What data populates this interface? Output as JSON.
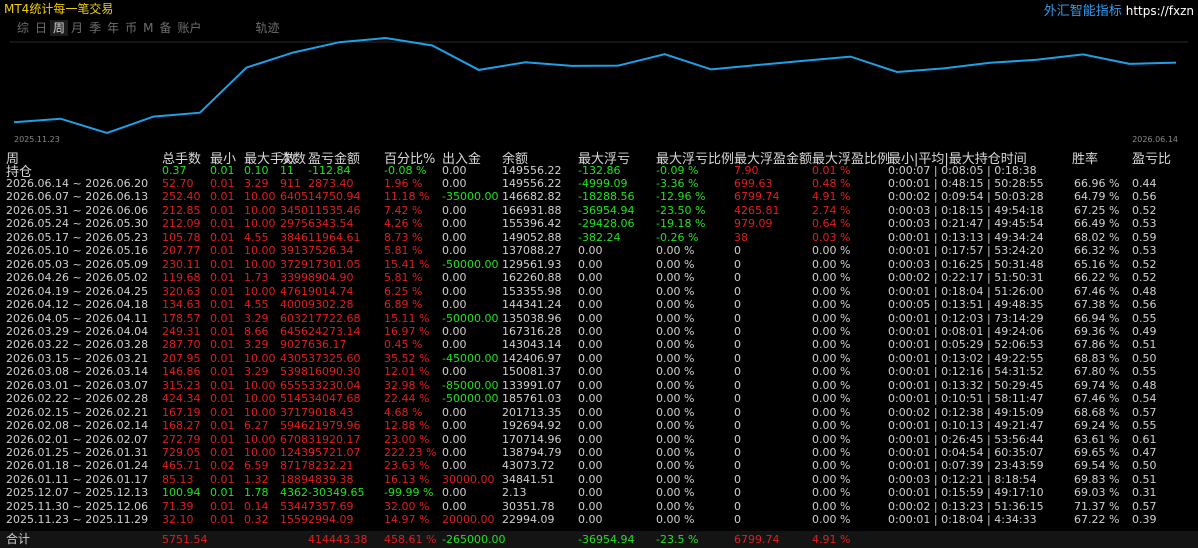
{
  "header": {
    "app_title": "MT4统计每一笔交易",
    "brand_name": "外汇智能指标",
    "brand_url": "https://fxzn"
  },
  "tabs": [
    {
      "label": "综",
      "active": false
    },
    {
      "label": "日",
      "active": false
    },
    {
      "label": "周",
      "active": true
    },
    {
      "label": "月",
      "active": false
    },
    {
      "label": "季",
      "active": false
    },
    {
      "label": "年",
      "active": false
    },
    {
      "label": "币",
      "active": false
    },
    {
      "label": "M",
      "active": false
    },
    {
      "label": "备",
      "active": false
    },
    {
      "label": "账户",
      "active": false
    },
    {
      "label": "轨迹",
      "active": false
    }
  ],
  "equity_curve": {
    "start_date": "2025.11.23",
    "end_date": "2026.06.14",
    "balance_points": [
      22994.09,
      30351.78,
      2.13,
      34841.51,
      43073.72,
      138794.79,
      170714.96,
      192694.92,
      201713.35,
      185761.03,
      133991.07,
      150081.37,
      142406.97,
      143043.14,
      167316.28,
      135038.96,
      144341.24,
      153355.98,
      162260.88,
      129561.93,
      137088.27,
      149052.88,
      155396.42,
      166931.88,
      146682.82,
      149556.22
    ]
  },
  "columns": {
    "period": "周",
    "total_lots": "总手数",
    "min_lot": "最小",
    "max_lot": "最大手数",
    "count": "次数",
    "profit": "盈亏金额",
    "percent": "百分比%",
    "deposit": "出入金",
    "balance": "余额",
    "max_floating_loss": "最大浮亏",
    "max_floating_loss_pct": "最大浮亏比例",
    "max_floating_profit": "最大浮盈金额",
    "max_floating_profit_pct": "最大浮盈比例",
    "hold_time": "最小|平均|最大持仓时间",
    "win_rate": "胜率",
    "pl_ratio": "盈亏比"
  },
  "holding_row": {
    "label": "持仓",
    "total_lots": "0.37",
    "min_lot": "0.01",
    "max_lot": "0.10",
    "count": "11",
    "profit": "-112.84",
    "percent": "-0.08 %",
    "deposit": "0.00",
    "balance": "149556.22",
    "max_floating_loss": "-132.86",
    "max_floating_loss_pct": "-0.09 %",
    "max_floating_profit": "7.90",
    "max_floating_profit_pct": "0.01 %",
    "hold_time": "0:00:07 | 0:08:05 | 0:18:38",
    "win_rate": "",
    "pl_ratio": ""
  },
  "rows": [
    {
      "period": "2026.06.14 ~ 2026.06.20",
      "total_lots": "52.70",
      "min_lot": "0.01",
      "max_lot": "3.29",
      "count": "911",
      "profit": "2873.40",
      "percent": "1.96 %",
      "deposit": "0.00",
      "balance": "149556.22",
      "max_floating_loss": "-4999.09",
      "max_floating_loss_pct": "-3.36 %",
      "max_floating_profit": "699.63",
      "max_floating_profit_pct": "0.48 %",
      "hold_time": "0:00:01 | 0:48:15 | 50:28:55",
      "win_rate": "66.96 %",
      "pl_ratio": "0.44",
      "sign": "pos"
    },
    {
      "period": "2026.06.07 ~ 2026.06.13",
      "total_lots": "252.40",
      "min_lot": "0.01",
      "max_lot": "10.00",
      "count": "6405",
      "profit": "14750.94",
      "percent": "11.18 %",
      "deposit": "-35000.00",
      "balance": "146682.82",
      "max_floating_loss": "-18288.56",
      "max_floating_loss_pct": "-12.96 %",
      "max_floating_profit": "6799.74",
      "max_floating_profit_pct": "4.91 %",
      "hold_time": "0:00:02 | 0:09:54 | 50:03:28",
      "win_rate": "64.79 %",
      "pl_ratio": "0.56",
      "sign": "pos"
    },
    {
      "period": "2026.05.31 ~ 2026.06.06",
      "total_lots": "212.85",
      "min_lot": "0.01",
      "max_lot": "10.00",
      "count": "3450",
      "profit": "11535.46",
      "percent": "7.42 %",
      "deposit": "0.00",
      "balance": "166931.88",
      "max_floating_loss": "-36954.94",
      "max_floating_loss_pct": "-23.50 %",
      "max_floating_profit": "4265.81",
      "max_floating_profit_pct": "2.74 %",
      "hold_time": "0:00:03 | 0:18:15 | 49:54:18",
      "win_rate": "67.25 %",
      "pl_ratio": "0.52",
      "sign": "pos"
    },
    {
      "period": "2026.05.24 ~ 2026.05.30",
      "total_lots": "212.09",
      "min_lot": "0.01",
      "max_lot": "10.00",
      "count": "2975",
      "profit": "6343.54",
      "percent": "4.26 %",
      "deposit": "0.00",
      "balance": "155396.42",
      "max_floating_loss": "-29428.06",
      "max_floating_loss_pct": "-19.18 %",
      "max_floating_profit": "979.09",
      "max_floating_profit_pct": "0.64 %",
      "hold_time": "0:00:03 | 0:21:47 | 49:45:54",
      "win_rate": "66.49 %",
      "pl_ratio": "0.53",
      "sign": "pos"
    },
    {
      "period": "2026.05.17 ~ 2026.05.23",
      "total_lots": "105.78",
      "min_lot": "0.01",
      "max_lot": "4.55",
      "count": "3846",
      "profit": "11964.61",
      "percent": "8.73 %",
      "deposit": "0.00",
      "balance": "149052.88",
      "max_floating_loss": "-382.24",
      "max_floating_loss_pct": "-0.26 %",
      "max_floating_profit": "38",
      "max_floating_profit_pct": "0.03 %",
      "hold_time": "0:00:01 | 0:13:13 | 49:34:24",
      "win_rate": "68.02 %",
      "pl_ratio": "0.59",
      "sign": "pos"
    },
    {
      "period": "2026.05.10 ~ 2026.05.16",
      "total_lots": "207.77",
      "min_lot": "0.01",
      "max_lot": "10.00",
      "count": "3913",
      "profit": "7526.34",
      "percent": "5.81 %",
      "deposit": "0.00",
      "balance": "137088.27",
      "max_floating_loss": "0.00",
      "max_floating_loss_pct": "0.00 %",
      "max_floating_profit": "0",
      "max_floating_profit_pct": "0.00 %",
      "hold_time": "0:00:01 | 0:17:57 | 53:24:20",
      "win_rate": "66.32 %",
      "pl_ratio": "0.53",
      "sign": "pos"
    },
    {
      "period": "2026.05.03 ~ 2026.05.09",
      "total_lots": "230.11",
      "min_lot": "0.01",
      "max_lot": "10.00",
      "count": "3729",
      "profit": "17301.05",
      "percent": "15.41 %",
      "deposit": "-50000.00",
      "balance": "129561.93",
      "max_floating_loss": "0.00",
      "max_floating_loss_pct": "0.00 %",
      "max_floating_profit": "0",
      "max_floating_profit_pct": "0.00 %",
      "hold_time": "0:00:03 | 0:16:25 | 50:31:48",
      "win_rate": "65.16 %",
      "pl_ratio": "0.52",
      "sign": "pos"
    },
    {
      "period": "2026.04.26 ~ 2026.05.02",
      "total_lots": "119.68",
      "min_lot": "0.01",
      "max_lot": "1.73",
      "count": "3399",
      "profit": "8904.90",
      "percent": "5.81 %",
      "deposit": "0.00",
      "balance": "162260.88",
      "max_floating_loss": "0.00",
      "max_floating_loss_pct": "0.00 %",
      "max_floating_profit": "0",
      "max_floating_profit_pct": "0.00 %",
      "hold_time": "0:00:02 | 0:22:17 | 51:50:31",
      "win_rate": "66.22 %",
      "pl_ratio": "0.52",
      "sign": "pos"
    },
    {
      "period": "2026.04.19 ~ 2026.04.25",
      "total_lots": "320.63",
      "min_lot": "0.01",
      "max_lot": "10.00",
      "count": "4761",
      "profit": "9014.74",
      "percent": "6.25 %",
      "deposit": "0.00",
      "balance": "153355.98",
      "max_floating_loss": "0.00",
      "max_floating_loss_pct": "0.00 %",
      "max_floating_profit": "0",
      "max_floating_profit_pct": "0.00 %",
      "hold_time": "0:00:01 | 0:18:04 | 51:26:00",
      "win_rate": "67.46 %",
      "pl_ratio": "0.48",
      "sign": "pos"
    },
    {
      "period": "2026.04.12 ~ 2026.04.18",
      "total_lots": "134.63",
      "min_lot": "0.01",
      "max_lot": "4.55",
      "count": "4000",
      "profit": "9302.28",
      "percent": "6.89 %",
      "deposit": "0.00",
      "balance": "144341.24",
      "max_floating_loss": "0.00",
      "max_floating_loss_pct": "0.00 %",
      "max_floating_profit": "0",
      "max_floating_profit_pct": "0.00 %",
      "hold_time": "0:00:05 | 0:13:51 | 49:48:35",
      "win_rate": "67.38 %",
      "pl_ratio": "0.56",
      "sign": "pos"
    },
    {
      "period": "2026.04.05 ~ 2026.04.11",
      "total_lots": "178.57",
      "min_lot": "0.01",
      "max_lot": "3.29",
      "count": "6032",
      "profit": "17722.68",
      "percent": "15.11 %",
      "deposit": "-50000.00",
      "balance": "135038.96",
      "max_floating_loss": "0.00",
      "max_floating_loss_pct": "0.00 %",
      "max_floating_profit": "0",
      "max_floating_profit_pct": "0.00 %",
      "hold_time": "0:00:01 | 0:12:03 | 73:14:29",
      "win_rate": "66.94 %",
      "pl_ratio": "0.55",
      "sign": "pos"
    },
    {
      "period": "2026.03.29 ~ 2026.04.04",
      "total_lots": "249.31",
      "min_lot": "0.01",
      "max_lot": "8.66",
      "count": "6456",
      "profit": "24273.14",
      "percent": "16.97 %",
      "deposit": "0.00",
      "balance": "167316.28",
      "max_floating_loss": "0.00",
      "max_floating_loss_pct": "0.00 %",
      "max_floating_profit": "0",
      "max_floating_profit_pct": "0.00 %",
      "hold_time": "0:00:01 | 0:08:01 | 49:24:06",
      "win_rate": "69.36 %",
      "pl_ratio": "0.49",
      "sign": "pos"
    },
    {
      "period": "2026.03.22 ~ 2026.03.28",
      "total_lots": "287.70",
      "min_lot": "0.01",
      "max_lot": "3.29",
      "count": "9027",
      "profit": "636.17",
      "percent": "0.45 %",
      "deposit": "0.00",
      "balance": "143043.14",
      "max_floating_loss": "0.00",
      "max_floating_loss_pct": "0.00 %",
      "max_floating_profit": "0",
      "max_floating_profit_pct": "0.00 %",
      "hold_time": "0:00:01 | 0:05:29 | 52:06:53",
      "win_rate": "67.86 %",
      "pl_ratio": "0.51",
      "sign": "pos"
    },
    {
      "period": "2026.03.15 ~ 2026.03.21",
      "total_lots": "207.95",
      "min_lot": "0.01",
      "max_lot": "10.00",
      "count": "4305",
      "profit": "37325.60",
      "percent": "35.52 %",
      "deposit": "-45000.00",
      "balance": "142406.97",
      "max_floating_loss": "0.00",
      "max_floating_loss_pct": "0.00 %",
      "max_floating_profit": "0",
      "max_floating_profit_pct": "0.00 %",
      "hold_time": "0:00:01 | 0:13:02 | 49:22:55",
      "win_rate": "68.83 %",
      "pl_ratio": "0.50",
      "sign": "pos"
    },
    {
      "period": "2026.03.08 ~ 2026.03.14",
      "total_lots": "146.86",
      "min_lot": "0.01",
      "max_lot": "3.29",
      "count": "5398",
      "profit": "16090.30",
      "percent": "12.01 %",
      "deposit": "0.00",
      "balance": "150081.37",
      "max_floating_loss": "0.00",
      "max_floating_loss_pct": "0.00 %",
      "max_floating_profit": "0",
      "max_floating_profit_pct": "0.00 %",
      "hold_time": "0:00:01 | 0:12:16 | 54:31:52",
      "win_rate": "67.80 %",
      "pl_ratio": "0.55",
      "sign": "pos"
    },
    {
      "period": "2026.03.01 ~ 2026.03.07",
      "total_lots": "315.23",
      "min_lot": "0.01",
      "max_lot": "10.00",
      "count": "6555",
      "profit": "33230.04",
      "percent": "32.98 %",
      "deposit": "-85000.00",
      "balance": "133991.07",
      "max_floating_loss": "0.00",
      "max_floating_loss_pct": "0.00 %",
      "max_floating_profit": "0",
      "max_floating_profit_pct": "0.00 %",
      "hold_time": "0:00:01 | 0:13:32 | 50:29:45",
      "win_rate": "69.74 %",
      "pl_ratio": "0.48",
      "sign": "pos"
    },
    {
      "period": "2026.02.22 ~ 2026.02.28",
      "total_lots": "424.34",
      "min_lot": "0.01",
      "max_lot": "10.00",
      "count": "5145",
      "profit": "34047.68",
      "percent": "22.44 %",
      "deposit": "-50000.00",
      "balance": "185761.03",
      "max_floating_loss": "0.00",
      "max_floating_loss_pct": "0.00 %",
      "max_floating_profit": "0",
      "max_floating_profit_pct": "0.00 %",
      "hold_time": "0:00:01 | 0:10:51 | 58:11:47",
      "win_rate": "67.46 %",
      "pl_ratio": "0.54",
      "sign": "pos"
    },
    {
      "period": "2026.02.15 ~ 2026.02.21",
      "total_lots": "167.19",
      "min_lot": "0.01",
      "max_lot": "10.00",
      "count": "3717",
      "profit": "9018.43",
      "percent": "4.68 %",
      "deposit": "0.00",
      "balance": "201713.35",
      "max_floating_loss": "0.00",
      "max_floating_loss_pct": "0.00 %",
      "max_floating_profit": "0",
      "max_floating_profit_pct": "0.00 %",
      "hold_time": "0:00:02 | 0:12:38 | 49:15:09",
      "win_rate": "68.68 %",
      "pl_ratio": "0.57",
      "sign": "pos"
    },
    {
      "period": "2026.02.08 ~ 2026.02.14",
      "total_lots": "168.27",
      "min_lot": "0.01",
      "max_lot": "6.27",
      "count": "5946",
      "profit": "21979.96",
      "percent": "12.88 %",
      "deposit": "0.00",
      "balance": "192694.92",
      "max_floating_loss": "0.00",
      "max_floating_loss_pct": "0.00 %",
      "max_floating_profit": "0",
      "max_floating_profit_pct": "0.00 %",
      "hold_time": "0:00:01 | 0:10:13 | 49:21:47",
      "win_rate": "69.24 %",
      "pl_ratio": "0.55",
      "sign": "pos"
    },
    {
      "period": "2026.02.01 ~ 2026.02.07",
      "total_lots": "272.79",
      "min_lot": "0.01",
      "max_lot": "10.00",
      "count": "6708",
      "profit": "31920.17",
      "percent": "23.00 %",
      "deposit": "0.00",
      "balance": "170714.96",
      "max_floating_loss": "0.00",
      "max_floating_loss_pct": "0.00 %",
      "max_floating_profit": "0",
      "max_floating_profit_pct": "0.00 %",
      "hold_time": "0:00:01 | 0:26:45 | 53:56:44",
      "win_rate": "63.61 %",
      "pl_ratio": "0.61",
      "sign": "pos"
    },
    {
      "period": "2026.01.25 ~ 2026.01.31",
      "total_lots": "729.05",
      "min_lot": "0.01",
      "max_lot": "10.00",
      "count": "12439",
      "profit": "95721.07",
      "percent": "222.23 %",
      "deposit": "0.00",
      "balance": "138794.79",
      "max_floating_loss": "0.00",
      "max_floating_loss_pct": "0.00 %",
      "max_floating_profit": "0",
      "max_floating_profit_pct": "0.00 %",
      "hold_time": "0:00:01 | 0:04:54 | 60:35:07",
      "win_rate": "69.65 %",
      "pl_ratio": "0.47",
      "sign": "pos"
    },
    {
      "period": "2026.01.18 ~ 2026.01.24",
      "total_lots": "465.71",
      "min_lot": "0.02",
      "max_lot": "6.59",
      "count": "8717",
      "profit": "8232.21",
      "percent": "23.63 %",
      "deposit": "0.00",
      "balance": "43073.72",
      "max_floating_loss": "0.00",
      "max_floating_loss_pct": "0.00 %",
      "max_floating_profit": "0",
      "max_floating_profit_pct": "0.00 %",
      "hold_time": "0:00:01 | 0:07:39 | 23:43:59",
      "win_rate": "69.54 %",
      "pl_ratio": "0.50",
      "sign": "pos"
    },
    {
      "period": "2026.01.11 ~ 2026.01.17",
      "total_lots": "85.13",
      "min_lot": "0.01",
      "max_lot": "1.32",
      "count": "1889",
      "profit": "4839.38",
      "percent": "16.13 %",
      "deposit": "30000.00",
      "balance": "34841.51",
      "max_floating_loss": "0.00",
      "max_floating_loss_pct": "0.00 %",
      "max_floating_profit": "0",
      "max_floating_profit_pct": "0.00 %",
      "hold_time": "0:00:03 | 0:12:21 | 8:18:54",
      "win_rate": "69.83 %",
      "pl_ratio": "0.51",
      "sign": "pos"
    },
    {
      "period": "2025.12.07 ~ 2025.12.13",
      "total_lots": "100.94",
      "min_lot": "0.01",
      "max_lot": "1.78",
      "count": "4362",
      "profit": "-30349.65",
      "percent": "-99.99 %",
      "deposit": "0.00",
      "balance": "2.13",
      "max_floating_loss": "0.00",
      "max_floating_loss_pct": "0.00 %",
      "max_floating_profit": "0",
      "max_floating_profit_pct": "0.00 %",
      "hold_time": "0:00:01 | 0:15:59 | 49:17:10",
      "win_rate": "69.03 %",
      "pl_ratio": "0.31",
      "sign": "neg"
    },
    {
      "period": "2025.11.30 ~ 2025.12.06",
      "total_lots": "71.39",
      "min_lot": "0.01",
      "max_lot": "0.14",
      "count": "5344",
      "profit": "7357.69",
      "percent": "32.00 %",
      "deposit": "0.00",
      "balance": "30351.78",
      "max_floating_loss": "0.00",
      "max_floating_loss_pct": "0.00 %",
      "max_floating_profit": "0",
      "max_floating_profit_pct": "0.00 %",
      "hold_time": "0:00:02 | 0:13:23 | 51:36:15",
      "win_rate": "71.37 %",
      "pl_ratio": "0.57",
      "sign": "pos"
    },
    {
      "period": "2025.11.23 ~ 2025.11.29",
      "total_lots": "32.10",
      "min_lot": "0.01",
      "max_lot": "0.32",
      "count": "1559",
      "profit": "2994.09",
      "percent": "14.97 %",
      "deposit": "20000.00",
      "balance": "22994.09",
      "max_floating_loss": "0.00",
      "max_floating_loss_pct": "0.00 %",
      "max_floating_profit": "0",
      "max_floating_profit_pct": "0.00 %",
      "hold_time": "0:00:01 | 0:18:04 | 4:34:33",
      "win_rate": "67.22 %",
      "pl_ratio": "0.39",
      "sign": "pos"
    }
  ],
  "totals": {
    "label": "合计",
    "total_lots": "5751.54",
    "profit": "414443.38",
    "percent": "458.61 %",
    "deposit": "-265000.00",
    "max_floating_loss": "-36954.94",
    "max_floating_loss_pct": "-23.5 %",
    "max_floating_profit": "6799.74",
    "max_floating_profit_pct": "4.91 %"
  },
  "colors": {
    "positive": "#e01e1e",
    "negative": "#20e020",
    "curve": "#1ea0e8",
    "title": "#f0d000"
  }
}
